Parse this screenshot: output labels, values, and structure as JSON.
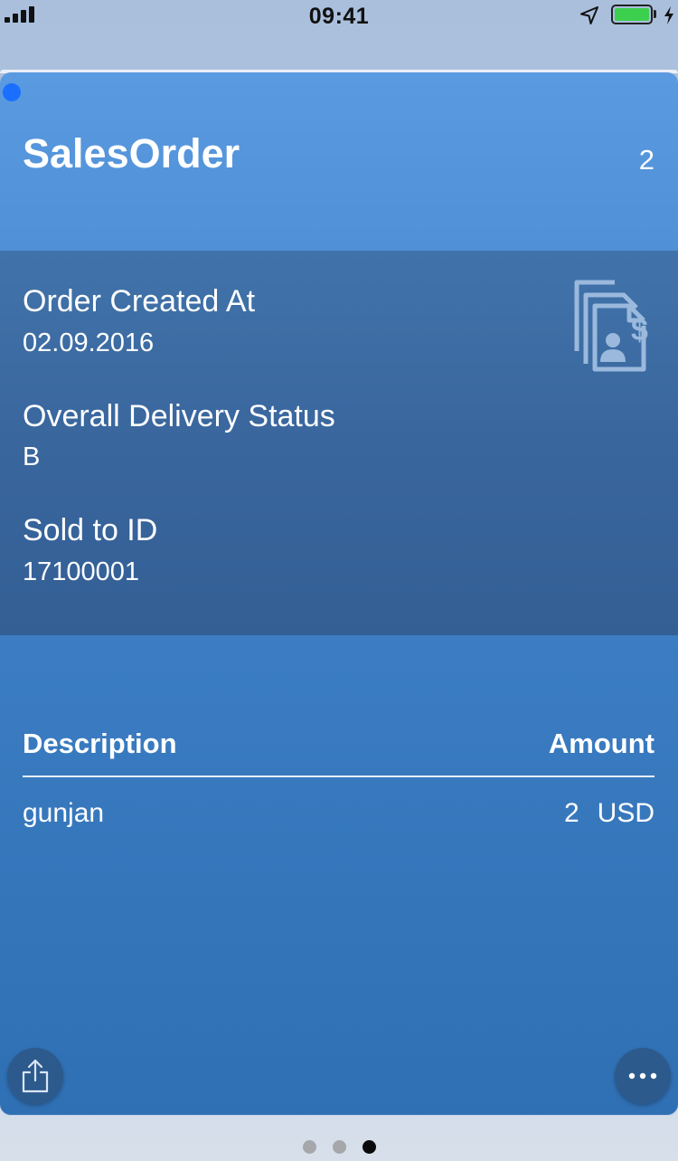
{
  "status_bar": {
    "time": "09:41",
    "icons": [
      "signal-icon",
      "location-icon",
      "battery-icon",
      "charging-icon"
    ]
  },
  "card": {
    "title": "SalesOrder",
    "count": "2",
    "fields": [
      {
        "label": "Order Created At",
        "value": "02.09.2016"
      },
      {
        "label": "Overall Delivery Status",
        "value": "B"
      },
      {
        "label": "Sold to ID",
        "value": "17100001"
      }
    ],
    "header_icon": "sales-document-icon",
    "table": {
      "columns": [
        "Description",
        "Amount"
      ],
      "rows": [
        {
          "description": "gunjan",
          "amount": "2",
          "currency": "USD"
        }
      ]
    },
    "actions": {
      "left_icon": "share-icon",
      "right_icon": "more-icon"
    }
  },
  "pager": {
    "total": 3,
    "active_index": 2
  },
  "colors": {
    "card_top": "#5a9ae0",
    "card_bottom": "#2f6fb3",
    "details_band": "#39669d",
    "unread_dot": "#1b6fff",
    "battery": "#3ccf4e"
  }
}
